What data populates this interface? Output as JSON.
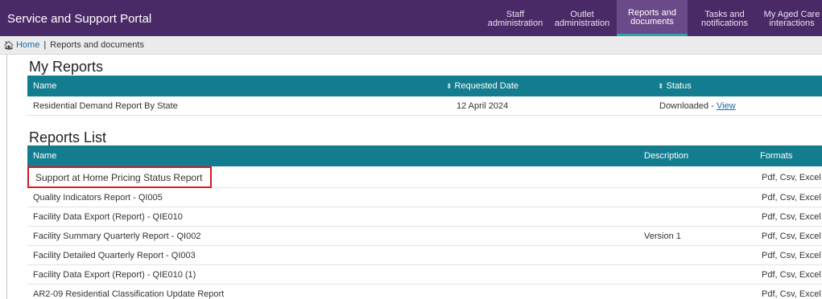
{
  "header": {
    "title": "Service and Support Portal",
    "nav": [
      {
        "label": "Staff\nadministration",
        "active": false
      },
      {
        "label": "Outlet\nadministration",
        "active": false
      },
      {
        "label": "Reports and\ndocuments",
        "active": true
      },
      {
        "label": "Tasks and\nnotifications",
        "active": false
      },
      {
        "label": "My Aged Care\ninteractions",
        "active": false
      }
    ]
  },
  "breadcrumb": {
    "home": "Home",
    "separator": "|",
    "current": "Reports and documents"
  },
  "my_reports": {
    "title": "My Reports",
    "columns": {
      "name": "Name",
      "requested_date": "Requested Date",
      "status": "Status"
    },
    "rows": [
      {
        "name": "Residential Demand Report By State",
        "requested_date": "12 April 2024",
        "status": "Downloaded - ",
        "link": "View"
      }
    ]
  },
  "reports_list": {
    "title": "Reports List",
    "columns": {
      "name": "Name",
      "description": "Description",
      "formats": "Formats"
    },
    "rows": [
      {
        "name": "Support at Home Pricing Status Report",
        "description": "",
        "formats": "Pdf, Csv, Excel"
      },
      {
        "name": "Quality Indicators Report - QI005",
        "description": "",
        "formats": "Pdf, Csv, Excel"
      },
      {
        "name": "Facility Data Export (Report) - QIE010",
        "description": "",
        "formats": "Pdf, Csv, Excel"
      },
      {
        "name": "Facility Summary Quarterly Report - QI002",
        "description": "Version 1",
        "formats": "Pdf, Csv, Excel"
      },
      {
        "name": "Facility Detailed Quarterly Report - QI003",
        "description": "",
        "formats": "Pdf, Csv, Excel"
      },
      {
        "name": "Facility Data Export (Report) - QIE010 (1)",
        "description": "",
        "formats": "Pdf, Csv, Excel"
      },
      {
        "name": "AR2-09 Residential Classification Update Report",
        "description": "",
        "formats": "Pdf, Csv, Excel"
      }
    ]
  },
  "colors": {
    "header_bg": "#4a2a66",
    "table_header_bg": "#137d8f",
    "link": "#137d8f",
    "highlight": "#d7191f"
  },
  "icons": {
    "home": "home-icon",
    "sort": "sort-icon"
  }
}
